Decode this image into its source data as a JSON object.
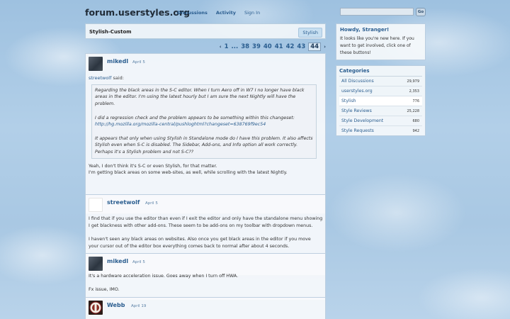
{
  "header": {
    "site_title": "forum.userstyles.org",
    "nav": [
      "Discussions",
      "Activity",
      "Sign In"
    ],
    "search_value": "",
    "search_button": "Go"
  },
  "category": {
    "title": "Stylish-Custom",
    "tag": "Stylish"
  },
  "pager": {
    "prev": "‹",
    "first": "1",
    "dots": "...",
    "pages": [
      "38",
      "39",
      "40",
      "41",
      "42",
      "43"
    ],
    "current": "44",
    "next": "›"
  },
  "posts": [
    {
      "author": "mikedl",
      "date": "April 5",
      "quote_author": "streetwolf",
      "quote_said": "said:",
      "quote_lines": [
        "Regarding the black areas in the S-C editor. When I turn Aero off in W7 I no longer have black",
        "areas in the editor. I'm using the latest hourly but I am sure the next Nightly will have the",
        "problem.",
        "",
        "I did a regression check and the problem appears to be something within this changeset:",
        "",
        "",
        "It appears that only when using Stylish in Standalone mode do I have this problem. It also affects",
        "Stylish even when S-C is disabled. The Sidebar, Add-ons, and Info option all work correctly.",
        "Perhaps it's a Stylish problem and not S-C??"
      ],
      "quote_link": "http://hg.mozilla.org/mozilla-central/pushloghtml?changeset=638769f9ec54",
      "body": [
        "Yeah, I don't think it's S-C or even Stylish, for that matter.",
        "I'm getting black areas on some web-sites, as well, while scrolling with the latest Nightly."
      ]
    },
    {
      "author": "streetwolf",
      "date": "April 5",
      "body": [
        "I find that if you use the editor than even if I exit the editor and only have the standalone menu showing",
        "I get blackness with other add-ons. These seem to be add-ons on my toolbar with dropdown menus.",
        "",
        "I haven't seen any black areas on websites. Also once you get black areas in the editor if you move",
        "your cursor out of the editor box everything comes back to normal after about 4 seconds."
      ]
    },
    {
      "author": "mikedl",
      "date": "April 5",
      "body": [
        "It's a hardware acceleration issue. Goes away when I turn off HWA.",
        "",
        "Fx issue, IMO."
      ]
    },
    {
      "author": "Webb",
      "date": "April 19",
      "body": []
    }
  ],
  "sidebar": {
    "howdy": {
      "title": "Howdy, Stranger!",
      "lines": [
        "It looks like you're new here. If you",
        "want to get involved, click one of",
        "these buttons!"
      ]
    },
    "categories": {
      "title": "Categories",
      "items": [
        {
          "name": "All Discussions",
          "count": "29,979"
        },
        {
          "name": "userstyles.org",
          "count": "2,353"
        },
        {
          "name": "Stylish",
          "count": "776"
        },
        {
          "name": "Style Reviews",
          "count": "25,228"
        },
        {
          "name": "Style Development",
          "count": "680"
        },
        {
          "name": "Style Requests",
          "count": "942"
        }
      ]
    }
  }
}
